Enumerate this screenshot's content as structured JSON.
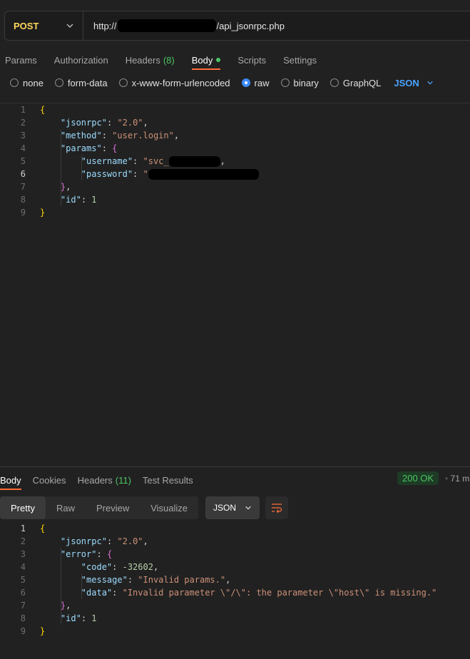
{
  "request": {
    "method": "POST",
    "url_prefix": "http://",
    "url_suffix": "/api_jsonrpc.php",
    "tabs": [
      {
        "label": "Params"
      },
      {
        "label": "Authorization"
      },
      {
        "label": "Headers",
        "count": "(8)"
      },
      {
        "label": "Body"
      },
      {
        "label": "Scripts"
      },
      {
        "label": "Settings"
      }
    ],
    "body_types": [
      "none",
      "form-data",
      "x-www-form-urlencoded",
      "raw",
      "binary",
      "GraphQL"
    ],
    "selected_body_type": "raw",
    "format": "JSON",
    "body_lines": [
      "1",
      "2",
      "3",
      "4",
      "5",
      "6",
      "7",
      "8",
      "9"
    ],
    "body": {
      "jsonrpc_key": "\"jsonrpc\"",
      "jsonrpc_val": "\"2.0\"",
      "method_key": "\"method\"",
      "method_val": "\"user.login\"",
      "params_key": "\"params\"",
      "username_key": "\"username\"",
      "username_val": "\"svc_",
      "password_key": "\"password\"",
      "password_val": "\"",
      "id_key": "\"id\"",
      "id_val": "1"
    }
  },
  "response": {
    "tabs": [
      {
        "label": "Body"
      },
      {
        "label": "Cookies"
      },
      {
        "label": "Headers",
        "count": "(11)"
      },
      {
        "label": "Test Results"
      }
    ],
    "status": "200 OK",
    "time": "71 m",
    "view_tabs": [
      "Pretty",
      "Raw",
      "Preview",
      "Visualize"
    ],
    "format": "JSON",
    "lines": [
      "1",
      "2",
      "3",
      "4",
      "5",
      "6",
      "7",
      "8",
      "9"
    ],
    "body": {
      "jsonrpc_key": "\"jsonrpc\"",
      "jsonrpc_val": "\"2.0\"",
      "error_key": "\"error\"",
      "code_key": "\"code\"",
      "code_val": "-32602",
      "message_key": "\"message\"",
      "message_val": "\"Invalid params.\"",
      "data_key": "\"data\"",
      "data_val": "\"Invalid parameter \\\"/\\\": the parameter \\\"host\\\" is missing.\"",
      "id_key": "\"id\"",
      "id_val": "1"
    }
  },
  "colors": {
    "accent": "#ff6c37",
    "method": "#ffd65c",
    "success": "#4cc764",
    "link": "#4aa3ff"
  }
}
